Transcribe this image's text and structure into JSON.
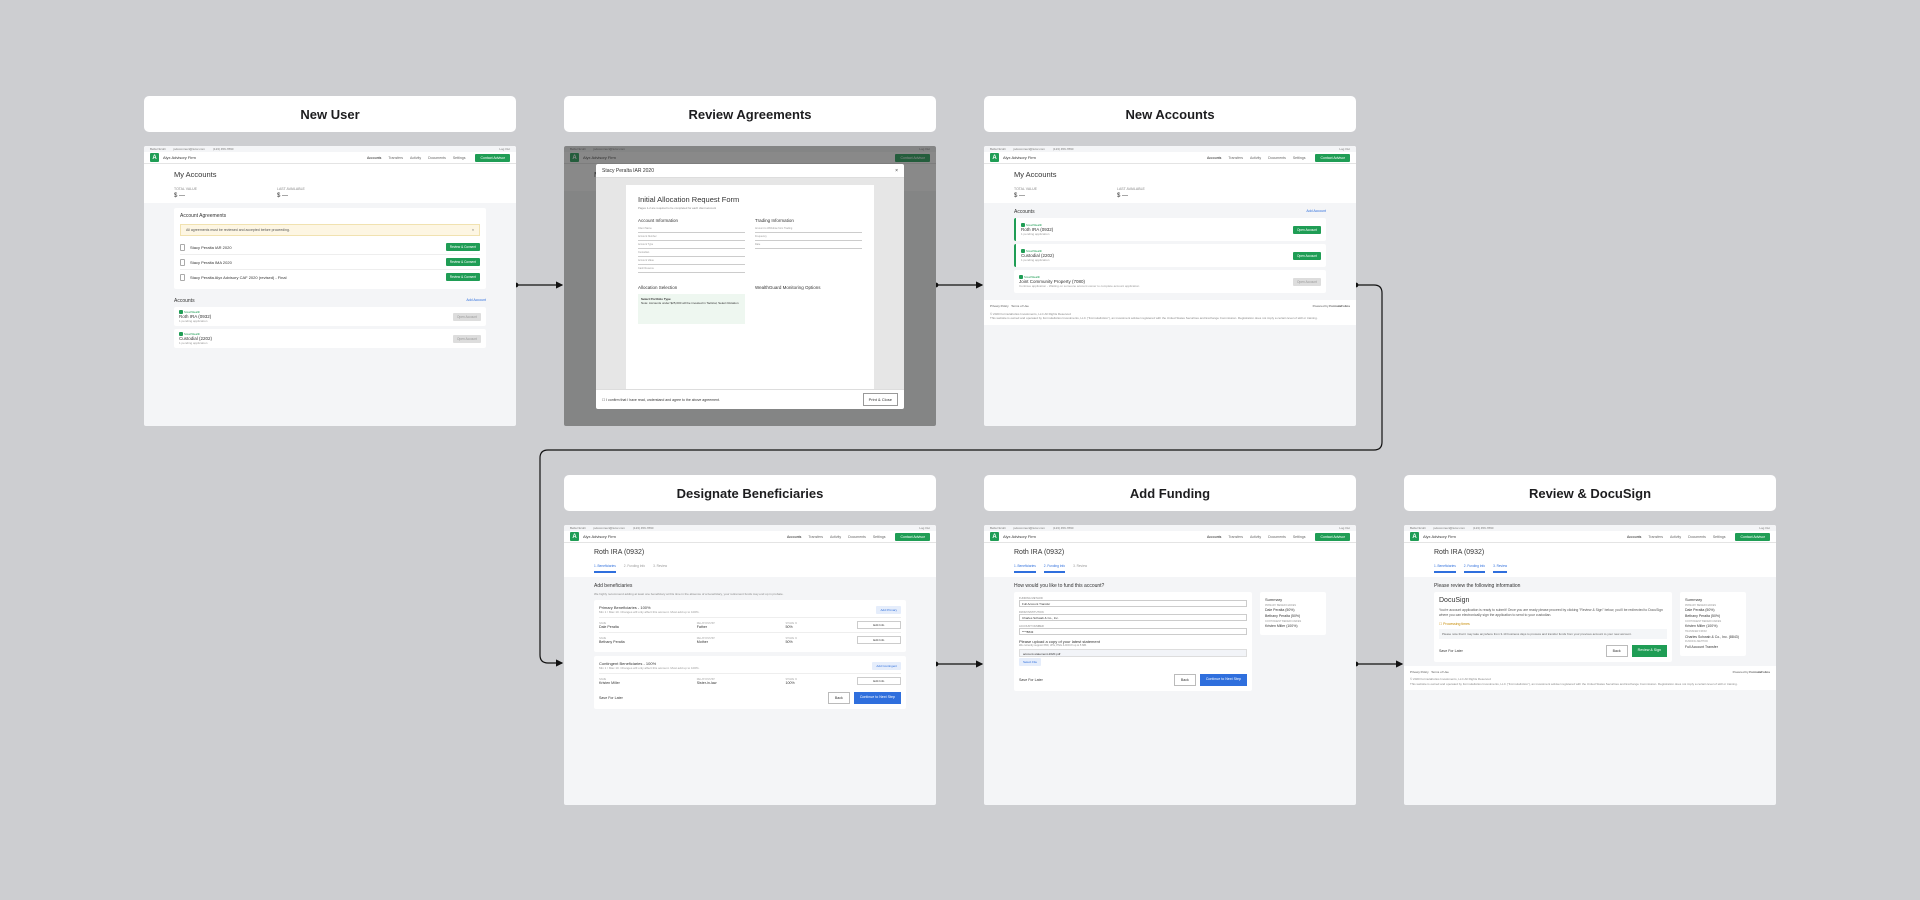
{
  "panels": {
    "new_user": "New User",
    "review_agreements": "Review Agreements",
    "new_accounts": "New Accounts",
    "designate_beneficiaries": "Designate Beneficiaries",
    "add_funding": "Add Funding",
    "review_docusign": "Review & DocuSign"
  },
  "app": {
    "top_left_1": "Bella Nicolli",
    "top_left_2": "jsdoconnect@tutor.com",
    "top_left_3": "(123) 456-7890",
    "logout": "Log Out",
    "logo": "A",
    "firm": "Alyx Advisory Firm",
    "nav": [
      "Accounts",
      "Transfers",
      "Activity",
      "Documents",
      "Settings"
    ],
    "contact": "Contact Advisor"
  },
  "accounts_page": {
    "title": "My Accounts",
    "total_value_label": "TOTAL VALUE",
    "last_updated_label": "LAST AVAILABLE",
    "value_symbol": "$",
    "value": "—",
    "agreements_title": "Account Agreements",
    "warning": "All agreements must be reviewed and accepted before proceeding.",
    "agreements": [
      {
        "name": "Stacy Peralta IAR 2020",
        "button": "Review & Consent"
      },
      {
        "name": "Stacy Peralta IMA 2020",
        "button": "Review & Consent"
      },
      {
        "name": "Stacy Peralta Alyx Advisory CAF 2020 (revised) - Final",
        "button": "Review & Consent"
      }
    ],
    "accounts_title": "Accounts",
    "add_account": "Add Account",
    "brand_badge": "SmartWealth",
    "accounts": [
      {
        "name": "Roth IRA (0932)",
        "status": "1 pending application",
        "button": "Open Account"
      },
      {
        "name": "Custodial (2202)",
        "status": "1 pending application",
        "button": "Open Account"
      },
      {
        "name": "Joint Community Property (7080)",
        "status": "Continue application - Waiting on someone account owner to complete account application",
        "button": "Open Account"
      }
    ]
  },
  "modal": {
    "title": "Stacy Peralta IAR 2020",
    "close": "×",
    "doc_title": "Initial Allocation Request Form",
    "doc_sub": "Pages 1-2 are required to be completed for each client account",
    "section_1": "Account Information",
    "section_2": "Trading Information",
    "section_3": "Allocation Selection",
    "section_4": "WealthGuard Monitoring Options",
    "fields_1": [
      "Client Name",
      "Account Number",
      "Account Type",
      "Custodian",
      "Account Value",
      "Cash Reserve"
    ],
    "fields_2": [
      "Amount to Withdraw from Trading",
      "Frequency",
      "Date"
    ],
    "portfolio": "Select Portfolio Type",
    "portfolio_note": "Note: Accounts under $25,000 will be invested in Tactical, Select Rotation",
    "agree": "I confirm that I have read, understand and agree to the above agreement.",
    "print_close": "Print & Close"
  },
  "footer": {
    "privacy": "Privacy Policy",
    "terms": "Terms of Use",
    "powered": "Powered by",
    "brand": "FormulaFolios",
    "copyright": "© 2020 FormulaFolios Investments, LLC All Rights Reserved",
    "disclaimer": "This website is owned and operated by FormulaFolios Investments, LLC (\"FormulaFolios\"), an investment adviser registered with the United States Securities and Exchange Commission. Registration does not imply a certain level of skill or training."
  },
  "wizard": {
    "account_title": "Roth IRA (0932)",
    "steps": [
      "1. Beneficiaries",
      "2. Funding Info",
      "3. Review"
    ],
    "save_later": "Save For Later",
    "back": "Back",
    "continue": "Continue to Next Step"
  },
  "beneficiaries": {
    "heading": "Add beneficiaries",
    "sub": "We highly recommend adding at least one beneficiary at this time in the absence of a beneficiary, your retirement funds may end up in probate.",
    "primary_title": "Primary Beneficiaries - 100%",
    "primary_sub": "Min 1 / Max 10. Changes will only affect this account. Must add up to 100%.",
    "add_primary": "Add Primary",
    "col_name": "NAME",
    "col_rel": "RELATIONSHIP",
    "col_share": "SHARE %",
    "primary": [
      {
        "name": "Dale Peralta",
        "rel": "Father",
        "share": "50%",
        "btn": "Edit Info"
      },
      {
        "name": "Bethany Peralta",
        "rel": "Mother",
        "share": "50%",
        "btn": "Edit Info"
      }
    ],
    "contingent_title": "Contingent Beneficiaries - 100%",
    "contingent_sub": "Min 1 / Max 10. Changes will only affect this account. Must add up to 100%.",
    "add_contingent": "Add Contingent",
    "contingent": [
      {
        "name": "Kristen Miller",
        "rel": "Sister-in-law",
        "share": "100%",
        "btn": "Edit Info"
      }
    ]
  },
  "funding": {
    "question": "How would you like to fund this account?",
    "method_label": "FUNDING METHOD",
    "method_value": "Full Account Transfer",
    "institution_label": "FROM INSTITUTION",
    "institution_value": "Charles Schwab & Co., Inc.",
    "account_label": "ACCOUNT NUMBER",
    "account_value": "****8843",
    "upload_title": "Please upload a copy of your latest statement",
    "upload_sub": "We currently support PDF, JPG, PNG & DOCX up to 5 MB.",
    "file": "account-statement-2020.pdf",
    "select_file": "Select File",
    "summary_title": "Summary",
    "summary_primary_label": "PRIMARY BENEFICIARIES",
    "summary_primary": [
      "Dale Peralta (50%)",
      "Bethany Peralta (50%)"
    ],
    "summary_contingent_label": "CONTINGENT BENEFICIARIES",
    "summary_contingent": "Kristen Miller (100%)",
    "summary_transfer_label": "TRANSFER FROM",
    "summary_transfer": "Charles Schwab & Co., Inc. (8843)",
    "summary_method_label": "FUNDING METHOD",
    "summary_method": "Full Account Transfer"
  },
  "docusign": {
    "heading": "Please review the following information",
    "title": "DocuSign",
    "text": "You're account application is ready to submit! Once you are ready please proceed by clicking \"Review & Sign\" below, you'll be redirected to DocuSign where you can electronically sign the application to send to your custodian.",
    "processing": "Processing times",
    "processing_text": "Please note that it may take anywhere from 3-10 business days to process and transfer funds from your previous account to your new account.",
    "review_sign": "Review & Sign"
  }
}
